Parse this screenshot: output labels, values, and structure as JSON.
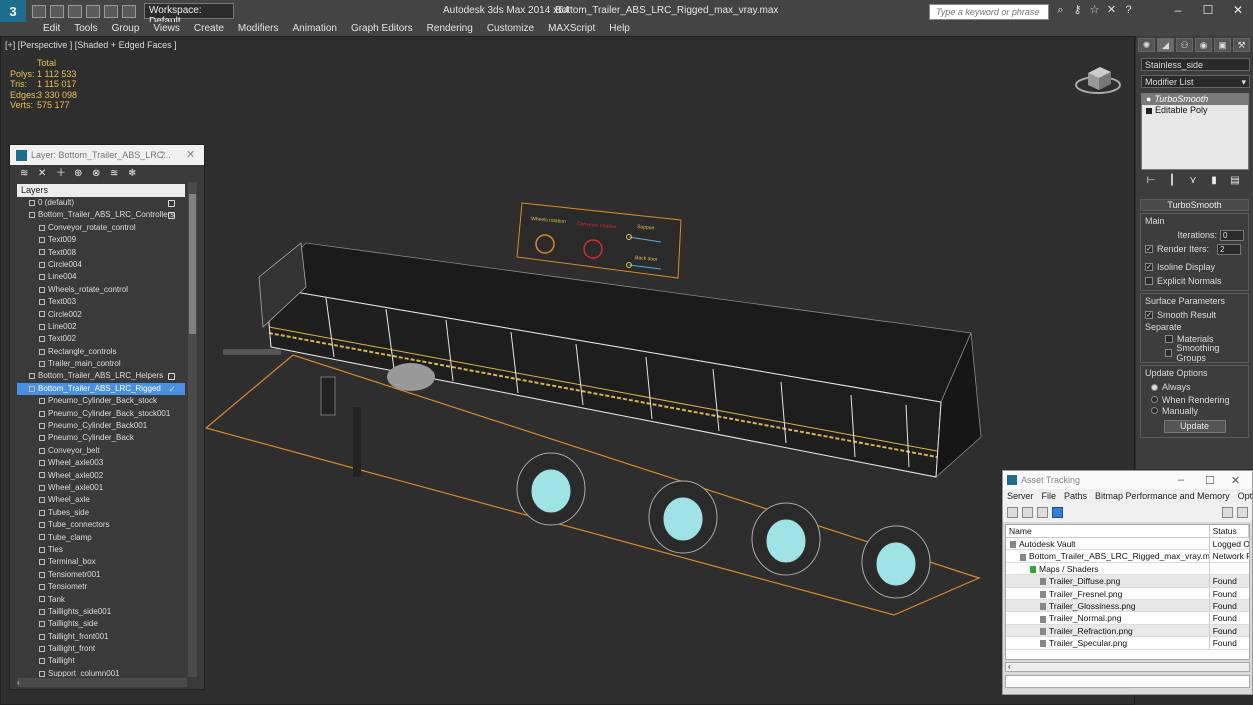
{
  "app": {
    "title": "Autodesk 3ds Max  2014 x64",
    "file": "Bottom_Trailer_ABS_LRC_Rigged_max_vray.max",
    "workspace": "Workspace: Default",
    "search_placeholder": "Type a keyword or phrase",
    "logo": "3"
  },
  "menu": [
    "Edit",
    "Tools",
    "Group",
    "Views",
    "Create",
    "Modifiers",
    "Animation",
    "Graph Editors",
    "Rendering",
    "Customize",
    "MAXScript",
    "Help"
  ],
  "viewport": {
    "label": "[+] [Perspective ] [Shaded + Edged Faces ]",
    "stats_header": "Total",
    "stats": [
      {
        "label": "Polys:",
        "value": "1 112 533"
      },
      {
        "label": "Tris:",
        "value": "1 115 017"
      },
      {
        "label": "Edges:",
        "value": "3 330 098"
      },
      {
        "label": "Verts:",
        "value": "575 177"
      }
    ],
    "control_panel": {
      "wheels_label": "Wheels rotation",
      "conveyor_label": "Conveyor rotation",
      "support_label": "Support",
      "back_door_label": "Back door"
    }
  },
  "command_panel": {
    "object_name": "Stainless_side",
    "modifier_list": "Modifier List",
    "stack": [
      {
        "label": "TurboSmooth",
        "selected": true
      },
      {
        "label": "Editable Poly",
        "selected": false
      }
    ],
    "rollout": "TurboSmooth",
    "main_group": "Main",
    "iterations_label": "Iterations:",
    "iterations": "0",
    "render_iters_label": "Render Iters:",
    "render_iters": "2",
    "isoline_label": "Isoline Display",
    "explicit_normals_label": "Explicit Normals",
    "surface_group": "Surface Parameters",
    "smooth_result_label": "Smooth Result",
    "separate_label": "Separate",
    "materials_label": "Materials",
    "smoothing_groups_label": "Smoothing Groups",
    "update_group": "Update Options",
    "always_label": "Always",
    "when_rendering_label": "When Rendering",
    "manually_label": "Manually",
    "update_button": "Update"
  },
  "layer_window": {
    "title": "Layer: Bottom_Trailer_ABS_LRC...",
    "help": "?",
    "close": "✕",
    "header": "Layers",
    "rows": [
      {
        "label": "0 (default)",
        "indent": 1,
        "kind": "layer",
        "box": true
      },
      {
        "label": "Bottom_Trailer_ABS_LRC_Controllers",
        "indent": 1,
        "kind": "layer",
        "box": true
      },
      {
        "label": "Conveyor_rotate_control",
        "indent": 2,
        "kind": "obj"
      },
      {
        "label": "Text009",
        "indent": 2,
        "kind": "obj"
      },
      {
        "label": "Text008",
        "indent": 2,
        "kind": "obj"
      },
      {
        "label": "Circle004",
        "indent": 2,
        "kind": "obj"
      },
      {
        "label": "Line004",
        "indent": 2,
        "kind": "obj"
      },
      {
        "label": "Wheels_rotate_control",
        "indent": 2,
        "kind": "obj"
      },
      {
        "label": "Text003",
        "indent": 2,
        "kind": "obj"
      },
      {
        "label": "Circle002",
        "indent": 2,
        "kind": "obj"
      },
      {
        "label": "Line002",
        "indent": 2,
        "kind": "obj"
      },
      {
        "label": "Text002",
        "indent": 2,
        "kind": "obj"
      },
      {
        "label": "Rectangle_controls",
        "indent": 2,
        "kind": "obj"
      },
      {
        "label": "Trailer_main_control",
        "indent": 2,
        "kind": "obj"
      },
      {
        "label": "Bottom_Trailer_ABS_LRC_Helpers",
        "indent": 1,
        "kind": "layer",
        "box": true
      },
      {
        "label": "Bottom_Trailer_ABS_LRC_Rigged",
        "indent": 1,
        "kind": "layer",
        "selected": true,
        "tick": true
      },
      {
        "label": "Pneumo_Cylinder_Back_stock",
        "indent": 2,
        "kind": "obj"
      },
      {
        "label": "Pneumo_Cylinder_Back_stock001",
        "indent": 2,
        "kind": "obj"
      },
      {
        "label": "Pneumo_Cylinder_Back001",
        "indent": 2,
        "kind": "obj"
      },
      {
        "label": "Pneumo_Cylinder_Back",
        "indent": 2,
        "kind": "obj"
      },
      {
        "label": "Conveyor_belt",
        "indent": 2,
        "kind": "obj"
      },
      {
        "label": "Wheel_axle003",
        "indent": 2,
        "kind": "obj"
      },
      {
        "label": "Wheel_axle002",
        "indent": 2,
        "kind": "obj"
      },
      {
        "label": "Wheel_axle001",
        "indent": 2,
        "kind": "obj"
      },
      {
        "label": "Wheel_axle",
        "indent": 2,
        "kind": "obj"
      },
      {
        "label": "Tubes_side",
        "indent": 2,
        "kind": "obj"
      },
      {
        "label": "Tube_connectors",
        "indent": 2,
        "kind": "obj"
      },
      {
        "label": "Tube_clamp",
        "indent": 2,
        "kind": "obj"
      },
      {
        "label": "Ties",
        "indent": 2,
        "kind": "obj"
      },
      {
        "label": "Terminal_box",
        "indent": 2,
        "kind": "obj"
      },
      {
        "label": "Tensiometr001",
        "indent": 2,
        "kind": "obj"
      },
      {
        "label": "Tensiometr",
        "indent": 2,
        "kind": "obj"
      },
      {
        "label": "Tank",
        "indent": 2,
        "kind": "obj"
      },
      {
        "label": "Taillights_side001",
        "indent": 2,
        "kind": "obj"
      },
      {
        "label": "Taillights_side",
        "indent": 2,
        "kind": "obj"
      },
      {
        "label": "Taillight_front001",
        "indent": 2,
        "kind": "obj"
      },
      {
        "label": "Taillight_front",
        "indent": 2,
        "kind": "obj"
      },
      {
        "label": "Taillight",
        "indent": 2,
        "kind": "obj"
      },
      {
        "label": "Support_column001",
        "indent": 2,
        "kind": "obj"
      }
    ]
  },
  "asset_window": {
    "title": "Asset Tracking",
    "menu": [
      "Server",
      "File",
      "Paths",
      "Bitmap Performance and Memory",
      "Options"
    ],
    "col_name": "Name",
    "col_status": "Status",
    "rows": [
      {
        "name": "Autodesk Vault",
        "status": "Logged O",
        "indent": 1
      },
      {
        "name": "Bottom_Trailer_ABS_LRC_Rigged_max_vray.max",
        "status": "Network F",
        "indent": 2
      },
      {
        "name": "Maps / Shaders",
        "status": "",
        "indent": 3
      },
      {
        "name": "Trailer_Diffuse.png",
        "status": "Found",
        "indent": 4
      },
      {
        "name": "Trailer_Fresnel.png",
        "status": "Found",
        "indent": 4
      },
      {
        "name": "Trailer_Glossiness.png",
        "status": "Found",
        "indent": 4
      },
      {
        "name": "Trailer_Normal.png",
        "status": "Found",
        "indent": 4
      },
      {
        "name": "Trailer_Refraction.png",
        "status": "Found",
        "indent": 4
      },
      {
        "name": "Trailer_Specular.png",
        "status": "Found",
        "indent": 4
      }
    ]
  },
  "colors": {
    "accent": "#4a90e2",
    "stats": "#e8c14e",
    "grid_outline": "#d98a2b",
    "hub": "#9fe3e6"
  }
}
